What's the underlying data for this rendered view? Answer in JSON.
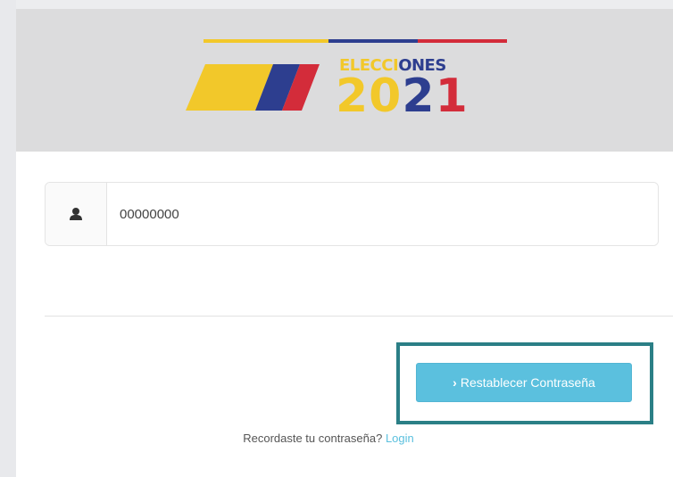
{
  "logo": {
    "word_part1": "ELECCI",
    "word_part2": "ONES",
    "year_part1": "20",
    "year_part2": "2",
    "year_part3": "1",
    "colors": {
      "yellow": "#f2c82a",
      "blue": "#2d3e8f",
      "red": "#d32c3a"
    }
  },
  "form": {
    "document_value": "00000000",
    "icon": "user-icon"
  },
  "reset_button": {
    "label": "Restablecer Contraseña",
    "icon": "chevron-right-icon",
    "color": "#5bc0de"
  },
  "highlight_color": "#2b7f86",
  "footer": {
    "question": "Recordaste tu contraseña?",
    "login_link": "Login"
  }
}
